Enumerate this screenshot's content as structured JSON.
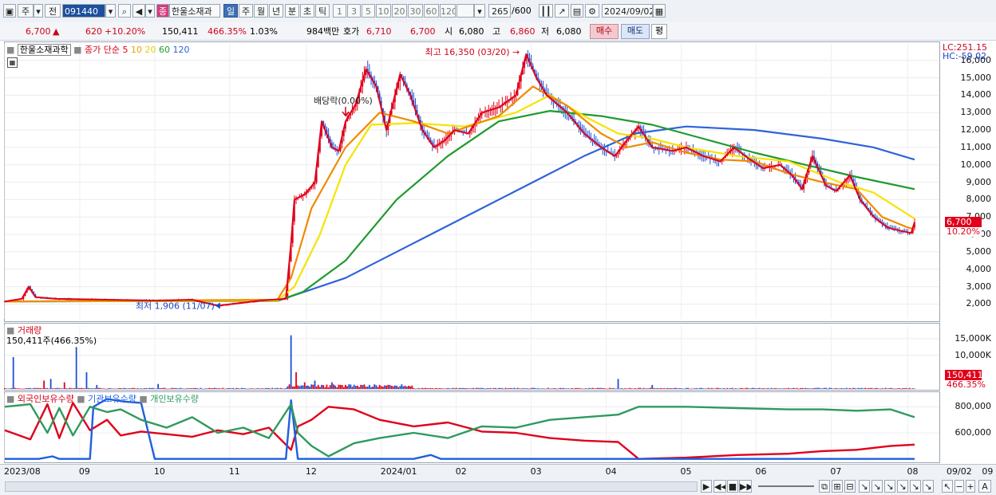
{
  "toolbar": {
    "market_label": "주",
    "prev_label": "전",
    "stock_code": "091440",
    "stock_name": "한울소재과",
    "period_buttons": [
      "일",
      "주",
      "월",
      "년",
      "분",
      "초",
      "틱"
    ],
    "interval_buttons": [
      "1",
      "3",
      "5",
      "10",
      "20",
      "30",
      "60",
      "120"
    ],
    "count_value": "265",
    "count_total": "/600",
    "date_value": "2024/09/02"
  },
  "quote": {
    "price": "6,700",
    "up_arrow": "▲",
    "change": "620",
    "change_pct": "+10.20%",
    "volume": "150,411",
    "volume_pct": "466.35%",
    "turnover_pct": "1.03%",
    "amount": "984백만",
    "ask_label": "호가",
    "ask1": "6,710",
    "ask2": "6,700",
    "open_label": "시",
    "open": "6,080",
    "high_label": "고",
    "high": "6,860",
    "low_label": "저",
    "low": "6,080",
    "buy_label": "매수",
    "sell_label": "매도",
    "eval_label": "평"
  },
  "price_panel": {
    "legend_name": "한울소재과학",
    "legend_ma_label": "종가 단순",
    "lc": "LC:251.15",
    "hc": "HC:-59.02",
    "high_annotation": "최고 16,350 (03/20)",
    "low_annotation": "최저 1,906 (11/07)",
    "dividend_annotation": "배당락(0.00%)",
    "current_price_tag": "6,700",
    "current_pct_tag": "10.20%"
  },
  "volume_panel": {
    "legend": "거래량",
    "value_label": "150,411주(466.35%)",
    "tag_value": "150,411",
    "tag_pct": "466.35%"
  },
  "holding_panel": {
    "legend_foreign": "외국인보유수량",
    "legend_inst": "기관보유수량",
    "legend_indiv": "개인보유수량"
  },
  "colors": {
    "up": "#e0001b",
    "down": "#1b4fd6",
    "ma5": "#e0001b",
    "ma10": "#f08a00",
    "ma20": "#f5e400",
    "ma60": "#1f9a2e",
    "ma120": "#2e63d8",
    "foreign": "#e0001b",
    "inst": "#1f5fe0",
    "indiv": "#2f9a5f"
  },
  "chart_data": [
    {
      "type": "candlestick",
      "title": "한울소재과학",
      "y_ticks": [
        2000,
        3000,
        4000,
        5000,
        6000,
        7000,
        8000,
        9000,
        10000,
        11000,
        12000,
        13000,
        14000,
        15000,
        16000
      ],
      "y_tick_labels": [
        "2,000",
        "3,000",
        "4,000",
        "5,000",
        "6,000",
        "7,000",
        "8,000",
        "9,000",
        "10,000",
        "11,000",
        "12,000",
        "13,000",
        "14,000",
        "15,000",
        "16,000"
      ],
      "ylim": [
        1150,
        16950
      ],
      "x_labels": [
        "2023/08",
        "09",
        "10",
        "11",
        "12",
        "2024/01",
        "02",
        "03",
        "04",
        "05",
        "06",
        "07",
        "08",
        "09"
      ],
      "right_x_label": "09/02",
      "ma_periods": [
        "5",
        "10",
        "20",
        "60",
        "120"
      ],
      "price_path": [
        [
          0,
          2150
        ],
        [
          10,
          2300
        ],
        [
          14,
          3000
        ],
        [
          18,
          2400
        ],
        [
          30,
          2300
        ],
        [
          60,
          2250
        ],
        [
          90,
          2200
        ],
        [
          110,
          2250
        ],
        [
          125,
          1906
        ],
        [
          150,
          2200
        ],
        [
          165,
          2300
        ],
        [
          168,
          5500
        ],
        [
          170,
          8000
        ],
        [
          176,
          8300
        ],
        [
          182,
          9000
        ],
        [
          186,
          12500
        ],
        [
          192,
          11000
        ],
        [
          196,
          10800
        ],
        [
          200,
          12500
        ],
        [
          206,
          13500
        ],
        [
          212,
          15500
        ],
        [
          218,
          14500
        ],
        [
          224,
          12000
        ],
        [
          232,
          15200
        ],
        [
          238,
          14000
        ],
        [
          245,
          12000
        ],
        [
          252,
          11000
        ],
        [
          258,
          11400
        ],
        [
          264,
          12000
        ],
        [
          272,
          11800
        ],
        [
          280,
          13000
        ],
        [
          290,
          13300
        ],
        [
          300,
          14000
        ],
        [
          306,
          16350
        ],
        [
          312,
          15000
        ],
        [
          318,
          14000
        ],
        [
          330,
          13000
        ],
        [
          340,
          11800
        ],
        [
          350,
          11000
        ],
        [
          358,
          10500
        ],
        [
          365,
          11400
        ],
        [
          372,
          12200
        ],
        [
          380,
          11000
        ],
        [
          392,
          10800
        ],
        [
          400,
          11000
        ],
        [
          410,
          10500
        ],
        [
          420,
          10200
        ],
        [
          428,
          11000
        ],
        [
          436,
          10400
        ],
        [
          445,
          9800
        ],
        [
          455,
          10000
        ],
        [
          462,
          9400
        ],
        [
          468,
          8600
        ],
        [
          474,
          10500
        ],
        [
          482,
          8800
        ],
        [
          488,
          8500
        ],
        [
          496,
          9400
        ],
        [
          502,
          8000
        ],
        [
          510,
          7000
        ],
        [
          518,
          6400
        ],
        [
          526,
          6200
        ],
        [
          532,
          6080
        ],
        [
          534,
          6700
        ]
      ],
      "ma_paths": {
        "ma10": [
          [
            0,
            2150
          ],
          [
            160,
            2250
          ],
          [
            168,
            3500
          ],
          [
            180,
            7500
          ],
          [
            200,
            11000
          ],
          [
            220,
            13000
          ],
          [
            240,
            12500
          ],
          [
            260,
            11800
          ],
          [
            290,
            12800
          ],
          [
            310,
            14500
          ],
          [
            330,
            13400
          ],
          [
            350,
            11800
          ],
          [
            365,
            11000
          ],
          [
            380,
            11300
          ],
          [
            400,
            10700
          ],
          [
            420,
            10300
          ],
          [
            440,
            10200
          ],
          [
            460,
            9500
          ],
          [
            480,
            9000
          ],
          [
            500,
            8600
          ],
          [
            515,
            7000
          ],
          [
            530,
            6400
          ],
          [
            534,
            6300
          ]
        ],
        "ma20": [
          [
            0,
            2150
          ],
          [
            160,
            2200
          ],
          [
            170,
            3000
          ],
          [
            185,
            6000
          ],
          [
            200,
            10000
          ],
          [
            215,
            12300
          ],
          [
            240,
            12400
          ],
          [
            270,
            12200
          ],
          [
            300,
            13000
          ],
          [
            320,
            14000
          ],
          [
            340,
            12800
          ],
          [
            360,
            11800
          ],
          [
            380,
            11500
          ],
          [
            400,
            11000
          ],
          [
            430,
            10500
          ],
          [
            460,
            10200
          ],
          [
            490,
            9000
          ],
          [
            510,
            8400
          ],
          [
            534,
            6900
          ]
        ],
        "ma60": [
          [
            0,
            2150
          ],
          [
            160,
            2180
          ],
          [
            175,
            2700
          ],
          [
            200,
            4500
          ],
          [
            230,
            8000
          ],
          [
            260,
            10500
          ],
          [
            290,
            12500
          ],
          [
            320,
            13100
          ],
          [
            350,
            12800
          ],
          [
            380,
            12300
          ],
          [
            410,
            11500
          ],
          [
            440,
            10700
          ],
          [
            470,
            10000
          ],
          [
            500,
            9300
          ],
          [
            534,
            8600
          ]
        ],
        "ma120": [
          [
            0,
            2150
          ],
          [
            160,
            2180
          ],
          [
            200,
            3500
          ],
          [
            250,
            6000
          ],
          [
            300,
            8500
          ],
          [
            340,
            10500
          ],
          [
            370,
            11800
          ],
          [
            400,
            12200
          ],
          [
            440,
            12000
          ],
          [
            480,
            11500
          ],
          [
            510,
            11000
          ],
          [
            534,
            10300
          ]
        ]
      }
    },
    {
      "type": "bar",
      "title": "거래량",
      "y_tick_labels": [
        "15,000K",
        "10,000K"
      ],
      "y_ticks": [
        15000,
        10000
      ],
      "ylim": [
        0,
        19000
      ],
      "unit": "K",
      "major_spikes": [
        [
          5,
          9500
        ],
        [
          23,
          2500
        ],
        [
          27,
          3000
        ],
        [
          35,
          2000
        ],
        [
          42,
          12500
        ],
        [
          48,
          5000
        ],
        [
          54,
          1200
        ],
        [
          90,
          1500
        ],
        [
          168,
          16000
        ],
        [
          171,
          5000
        ],
        [
          176,
          2000
        ],
        [
          182,
          2500
        ],
        [
          192,
          2000
        ],
        [
          360,
          3000
        ],
        [
          380,
          1200
        ],
        [
          534,
          150.411
        ]
      ]
    },
    {
      "type": "line",
      "title": "보유수량",
      "y_tick_labels": [
        "800,000",
        "600,000"
      ],
      "y_ticks": [
        800000,
        600000
      ],
      "ylim": [
        380000,
        900000
      ],
      "series": [
        {
          "name": "외국인보유수량",
          "path": [
            [
              0,
              620000
            ],
            [
              15,
              550000
            ],
            [
              25,
              820000
            ],
            [
              32,
              560000
            ],
            [
              40,
              830000
            ],
            [
              50,
              620000
            ],
            [
              60,
              700000
            ],
            [
              68,
              580000
            ],
            [
              80,
              610000
            ],
            [
              95,
              590000
            ],
            [
              110,
              570000
            ],
            [
              125,
              620000
            ],
            [
              140,
              590000
            ],
            [
              155,
              640000
            ],
            [
              168,
              470000
            ],
            [
              172,
              650000
            ],
            [
              180,
              700000
            ],
            [
              190,
              800000
            ],
            [
              205,
              780000
            ],
            [
              220,
              700000
            ],
            [
              240,
              650000
            ],
            [
              260,
              680000
            ],
            [
              280,
              610000
            ],
            [
              300,
              600000
            ],
            [
              320,
              560000
            ],
            [
              340,
              540000
            ],
            [
              360,
              530000
            ],
            [
              372,
              400000
            ],
            [
              400,
              410000
            ],
            [
              430,
              430000
            ],
            [
              460,
              440000
            ],
            [
              480,
              460000
            ],
            [
              500,
              470000
            ],
            [
              520,
              500000
            ],
            [
              534,
              510000
            ]
          ]
        },
        {
          "name": "기관보유수량",
          "path": [
            [
              0,
              400000
            ],
            [
              20,
              400000
            ],
            [
              28,
              420000
            ],
            [
              32,
              400000
            ],
            [
              50,
              400000
            ],
            [
              52,
              800000
            ],
            [
              60,
              860000
            ],
            [
              70,
              840000
            ],
            [
              80,
              830000
            ],
            [
              88,
              400000
            ],
            [
              160,
              400000
            ],
            [
              165,
              400000
            ],
            [
              168,
              850000
            ],
            [
              172,
              400000
            ],
            [
              200,
              400000
            ],
            [
              240,
              400000
            ],
            [
              250,
              430000
            ],
            [
              256,
              400000
            ],
            [
              534,
              400000
            ]
          ]
        },
        {
          "name": "개인보유수량",
          "path": [
            [
              0,
              800000
            ],
            [
              15,
              820000
            ],
            [
              25,
              600000
            ],
            [
              32,
              790000
            ],
            [
              40,
              580000
            ],
            [
              50,
              800000
            ],
            [
              60,
              760000
            ],
            [
              68,
              780000
            ],
            [
              80,
              700000
            ],
            [
              95,
              640000
            ],
            [
              110,
              720000
            ],
            [
              125,
              600000
            ],
            [
              140,
              640000
            ],
            [
              155,
              560000
            ],
            [
              168,
              820000
            ],
            [
              172,
              600000
            ],
            [
              180,
              500000
            ],
            [
              190,
              420000
            ],
            [
              205,
              520000
            ],
            [
              220,
              560000
            ],
            [
              240,
              600000
            ],
            [
              260,
              560000
            ],
            [
              280,
              650000
            ],
            [
              300,
              640000
            ],
            [
              320,
              700000
            ],
            [
              340,
              720000
            ],
            [
              360,
              740000
            ],
            [
              372,
              800000
            ],
            [
              400,
              800000
            ],
            [
              430,
              790000
            ],
            [
              460,
              780000
            ],
            [
              480,
              780000
            ],
            [
              500,
              770000
            ],
            [
              520,
              780000
            ],
            [
              534,
              720000
            ]
          ]
        }
      ]
    }
  ]
}
